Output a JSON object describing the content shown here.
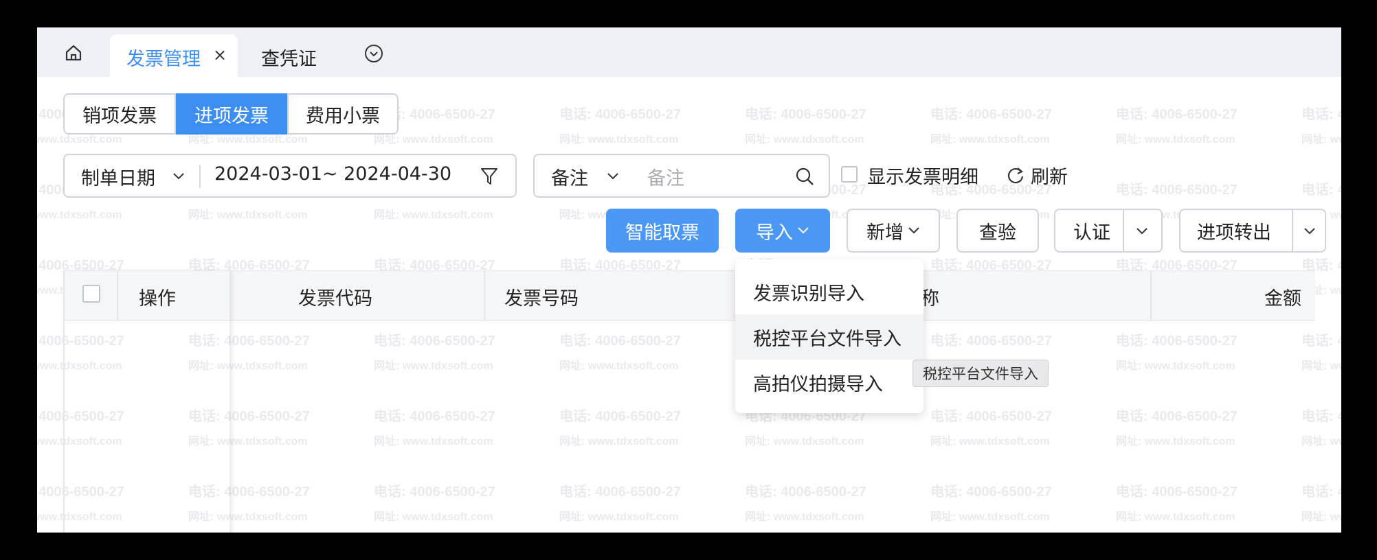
{
  "watermark": {
    "phone": "电话: 4006-6500-27",
    "url": "网址: www.tdxsoft.com"
  },
  "tabs": {
    "home_icon": "home-icon",
    "active": {
      "label": "发票管理",
      "close": "×"
    },
    "second": {
      "label": "查凭证"
    },
    "more_icon": "chevron-circle-down-icon"
  },
  "segments": [
    "销项发票",
    "进项发票",
    "费用小票"
  ],
  "active_segment": "进项发票",
  "filters": {
    "date_field": "制单日期",
    "date_range": "2024-03-01~ 2024-04-30",
    "remark_field": "备注",
    "remark_placeholder": "备注",
    "show_detail": "显示发票明细",
    "refresh": "刷新"
  },
  "toolbar": {
    "smart_fetch": "智能取票",
    "import": "导入",
    "add": "新增",
    "verify": "查验",
    "certify": "认证",
    "transfer_out": "进项转出"
  },
  "import_menu": [
    "发票识别导入",
    "税控平台文件导入",
    "高拍仪拍摄导入"
  ],
  "tooltip": "税控平台文件导入",
  "table": {
    "headers": {
      "action": "操作",
      "code": "发票代码",
      "number": "发票号码",
      "name_partial": "称",
      "amount": "金额"
    }
  },
  "colors": {
    "accent": "#3d8ef0",
    "tab_bg": "#edf1f5"
  }
}
